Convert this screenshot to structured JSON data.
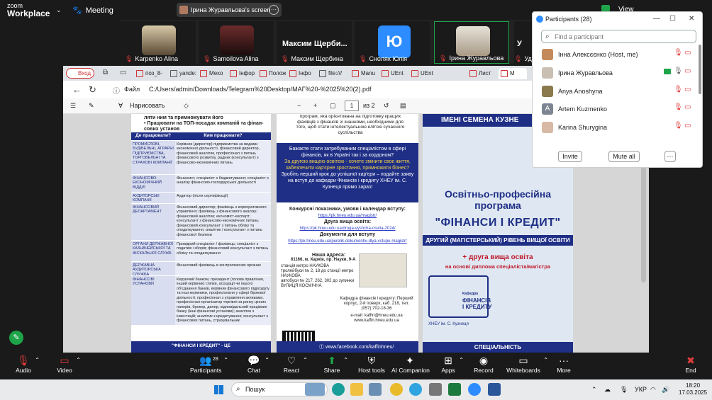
{
  "topbar": {
    "logo_line1": "zoom",
    "logo_line2": "Workplace",
    "meeting_label": "Meeting",
    "screen_label": "Ірина Журавльова's screen",
    "view_label": "View"
  },
  "video_strip": [
    {
      "name": "Karpenko Alina",
      "big": ""
    },
    {
      "name": "Samoilova Alina",
      "big": ""
    },
    {
      "name": "Максим Щербина",
      "big": "Максим  Щерби..."
    },
    {
      "name": "Сноляк Юлія",
      "big": ""
    },
    {
      "name": "Ірина Журавльова",
      "big": ""
    },
    {
      "name": "Удо",
      "big": "У"
    }
  ],
  "tile_ju_letter": "Ю",
  "browser": {
    "vxod": "Вход",
    "tabs": [
      "поз_8-",
      "yande:",
      "Мехо",
      "Інфор",
      "Полож",
      "Інфо",
      "file:///",
      "Manu",
      "UEnt",
      "UEnt",
      "Лист",
      "М"
    ],
    "file_label": "Файл",
    "url": "C:/Users/admin/Downloads/Telegram%20Desktop/МАГ%20-%2025%20(2).pdf",
    "draw_label": "Нарисовать",
    "page_current": "1",
    "page_of": "из 2"
  },
  "pdf": {
    "left_header": [
      "ляти ним та примножувати його",
      "• Працювати на ТОП-посадах компаній та фінан-",
      "  сових установ"
    ],
    "table_header": [
      "Де працювати?",
      "Ким працювати?"
    ],
    "table_rows": [
      [
        "ПРОМИСЛОВІ, БУДІВЕЛЬНІ, АГРАРНІ ПІДПРИЄМСТВА, ТОРГОВЕЛЬНІ ТА СТРАХОВІ КОМПАНІЇ",
        "Керівник (директор) підприємства за видами економічної діяльності, фінансовий директор, фінансовий аналітик, професіонал з питань фінансового розвитку, радник (консультант) з фінансово-економічних питань"
      ],
      [
        "ФІНАНСОВО-ЕКОНОМІЧНИЙ ВІДДІЛ",
        "Фінансист, спеціаліст з бюджетування; спеціаліст з аналізу фінансово-господарської діяльності"
      ],
      [
        "АУДИТОРСЬКІ КОМПАНІЇ",
        "Аудитор (після сертифікації)"
      ],
      [
        "ФІНАНСОВИЙ ДЕПАРТАМЕНТ",
        "Фінансовий директор; фахівець з корпоративного управління; фахівець з фінансового аналізу; фінансовий аналітик; економіст-експерт; консультант з фінансово-економічних питань; фінансовий консультант з питань обліку та оподаткування; аналітик / консультант з питань фінансової безпеки"
      ],
      [
        "ОРГАНИ ДЕРЖАВНОЇ КАЗНАЧЕЙСЬКОЇ ТА ФІСКАЛЬНОЇ СЛУЖБ",
        "Провідний спеціаліст / фахівець; спеціаліст з податків і зборів; фінансовий консультант з питань обліку та оподаткування"
      ],
      [
        "ДЕРЖАВНА АУДИТОРСЬКА СЛУЖБА",
        "Фінансовий фахівець в контролюючих органах"
      ],
      [
        "ФІНАНСОВІ УСТАНОВИ",
        "Керуючий банком, президент (голова правління, інший керівник) спілки, асоціації чи іншого об'єднання банків, керівник фінансового підрозділу та інші керівники, професіонали у сфері біржової діяльності; професіонал з управління активами, професіонал-організатор торгівлі на ринку цінних паперів, брокер, дилер, відповідальний працівник банку (інші фінансові установи); аналітик з інвестицій; аналітик з кредитування; консультант з фінансових питань, страхувальник"
      ]
    ],
    "left_footer": "\"ФІНАНСИ І КРЕДИТ\" - ЦЕ",
    "mid_intro": "програм, яка орієнтована на підготовку кращих фахівців з фінансів зі знаннями, необхідними для того, щоб стати інтелектуальною елітою сучасного суспільства",
    "mid_blue_1": "Бажаєте стати затребуваним спеціалістом в сфері фінансів, як в Україні так і за кордоном?",
    "mid_blue_2": "За другою вищою освітою - хочете змінити своє життя, забезпечити кар'єрне зростання, примножити бізнес?",
    "mid_blue_3": "Зробіть перший крок до успішної кар'єри – подайте заяву на вступ до кафедри Фінансів і кредиту ХНЕУ ім. С. Кузнеця прямо зараз!",
    "mid_comp": "Конкурсні показники, умови і календар вступу:",
    "mid_link1": "https://pk.hneu.edu.ua/magistr/",
    "mid_second": "Друга вища освіта:",
    "mid_link2": "https://pk.hneu.edu.ua/druga-vyshcha-osvita-2024/",
    "mid_docs": "Документи для вступу",
    "mid_link3": "https://pk.hneu.edu.ua/perelik-dokumentiv-dlya-vstupu-magistr/",
    "mid_addr_title": "Наша адреса:",
    "mid_addr": "61166, м. Харків, пр. Науки, 9-А",
    "mid_metro1": "станція метро  НАУКОВА",
    "mid_trol": "тролейбуси № 2, 18 до станції метро НАУКОВА",
    "mid_bus": "автобуси  № 217, 262, 302 до зупинки ВУЛИЦЯ КОСМІЧНА",
    "mid_kaf": "Кафедра фінансів і кредиту: Перший корпус, 2-й поверх, каб. 218, тел. (057) 702-18-36",
    "mid_email": "e-mail: kaffin@hneu.edu.ua",
    "mid_web": "www.kaffin.hneu.edu.ua",
    "mid_fb": "www.facebook.com/kaffinhneu/",
    "right_top": "ІМЕНІ СЕМЕНА КУЗНЕ",
    "right_t1": "Освітньо-професійна програма",
    "right_t2": "\"ФІНАНСИ І КРЕДИТ\"",
    "right_t3": "ДРУГИЙ (МАГІСТЕРСЬКИЙ) РІВЕНЬ ВИЩОЇ ОСВІТИ",
    "right_t4": "+ друга вища освіта",
    "right_t5": "на основі диплома спеціаліста/магістра",
    "right_emb_small": "Кафедра",
    "right_emb_1": "ФІНАНСІВ",
    "right_emb_2": "І КРЕДИТУ",
    "right_hneu": "ХНЕУ ім. С. Кузнеця",
    "right_bottom": "СПЕЦІАЛЬНІСТЬ"
  },
  "participants": {
    "title": "Participants (28)",
    "search_placeholder": "Find a participant",
    "list": [
      {
        "name": "Інна Алексєєнко (Host, me)"
      },
      {
        "name": "Ірина Журавльова"
      },
      {
        "name": "Anya Anoshyna"
      },
      {
        "name": "Artem Kuzmenko"
      },
      {
        "name": "Karina Shurygina"
      }
    ],
    "artem_letter": "A",
    "invite": "Invite",
    "mute_all": "Mute all",
    "more": "···"
  },
  "toolbar": {
    "audio": "Audio",
    "video": "Video",
    "participants": "Participants",
    "participants_count": "28",
    "chat": "Chat",
    "react": "React",
    "share": "Share",
    "host_tools": "Host tools",
    "ai_companion": "AI Companion",
    "apps": "Apps",
    "record": "Record",
    "whiteboards": "Whiteboards",
    "more": "More",
    "end": "End"
  },
  "taskbar": {
    "search": "Пошук",
    "lang": "УКР",
    "time": "18:20",
    "date": "17.03.2025"
  }
}
